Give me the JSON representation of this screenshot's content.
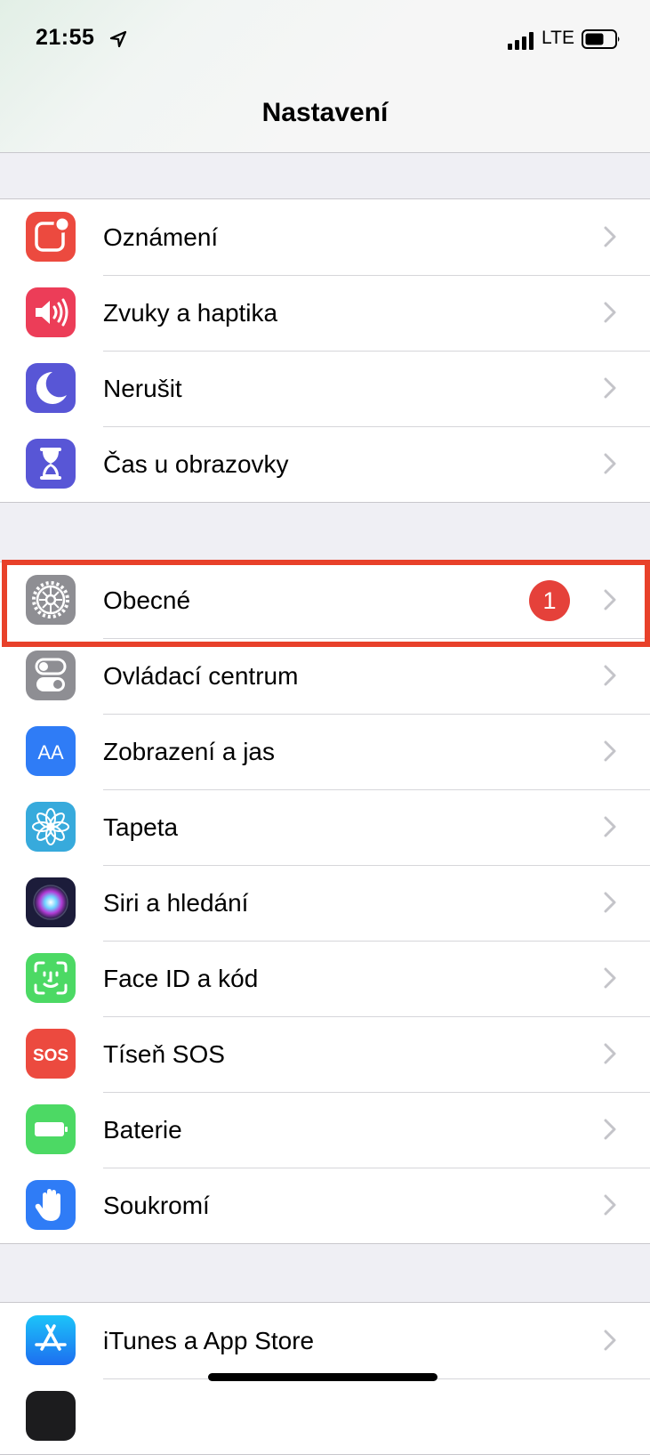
{
  "status_bar": {
    "time": "21:55",
    "carrier": "LTE"
  },
  "header": {
    "title": "Nastavení"
  },
  "groups": [
    {
      "items": [
        {
          "label": "Oznámení",
          "icon": "notifications-icon",
          "color": "#ec4a3f"
        },
        {
          "label": "Zvuky a haptika",
          "icon": "speaker-icon",
          "color": "#ec3d58"
        },
        {
          "label": "Nerušit",
          "icon": "moon-icon",
          "color": "#5856d6"
        },
        {
          "label": "Čas u obrazovky",
          "icon": "hourglass-icon",
          "color": "#5856d6"
        }
      ]
    },
    {
      "items": [
        {
          "label": "Obecné",
          "icon": "gear-icon",
          "color": "#8e8e93",
          "badge": "1"
        },
        {
          "label": "Ovládací centrum",
          "icon": "toggles-icon",
          "color": "#8e8e93"
        },
        {
          "label": "Zobrazení a jas",
          "icon": "text-size-icon",
          "color": "#2f7cf6",
          "icon_text": "AA"
        },
        {
          "label": "Tapeta",
          "icon": "flower-icon",
          "color": "#37aadc"
        },
        {
          "label": "Siri a hledání",
          "icon": "siri-icon",
          "color": "#1c1c3a"
        },
        {
          "label": "Face ID a kód",
          "icon": "face-id-icon",
          "color": "#4cd964"
        },
        {
          "label": "Tíseň SOS",
          "icon": "sos-icon",
          "color": "#ec4a3f",
          "icon_text": "SOS"
        },
        {
          "label": "Baterie",
          "icon": "battery-icon",
          "color": "#4cd964"
        },
        {
          "label": "Soukromí",
          "icon": "hand-icon",
          "color": "#2f7cf6"
        }
      ]
    },
    {
      "items": [
        {
          "label": "iTunes a App Store",
          "icon": "app-store-icon",
          "color": "#1f8ef1"
        }
      ]
    }
  ],
  "highlight_color": "#e8412a"
}
